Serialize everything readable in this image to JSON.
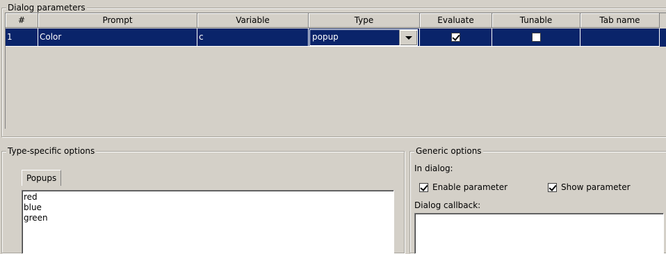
{
  "dialog_parameters": {
    "title": "Dialog parameters",
    "columns": [
      "#",
      "Prompt",
      "Variable",
      "Type",
      "Evaluate",
      "Tunable",
      "Tab name"
    ],
    "rows": [
      {
        "index": "1",
        "prompt": "Color",
        "variable": "c",
        "type": "popup",
        "evaluate": true,
        "tunable": false,
        "tab_name": ""
      }
    ]
  },
  "type_specific_options": {
    "title": "Type-specific options",
    "tab": "Popups",
    "items": [
      "red",
      "blue",
      "green"
    ]
  },
  "generic_options": {
    "title": "Generic options",
    "in_dialog_label": "In dialog:",
    "enable_parameter": {
      "label": "Enable parameter",
      "checked": true
    },
    "show_parameter": {
      "label": "Show parameter",
      "checked": true
    },
    "dialog_callback_label": "Dialog callback:",
    "dialog_callback_value": ""
  }
}
